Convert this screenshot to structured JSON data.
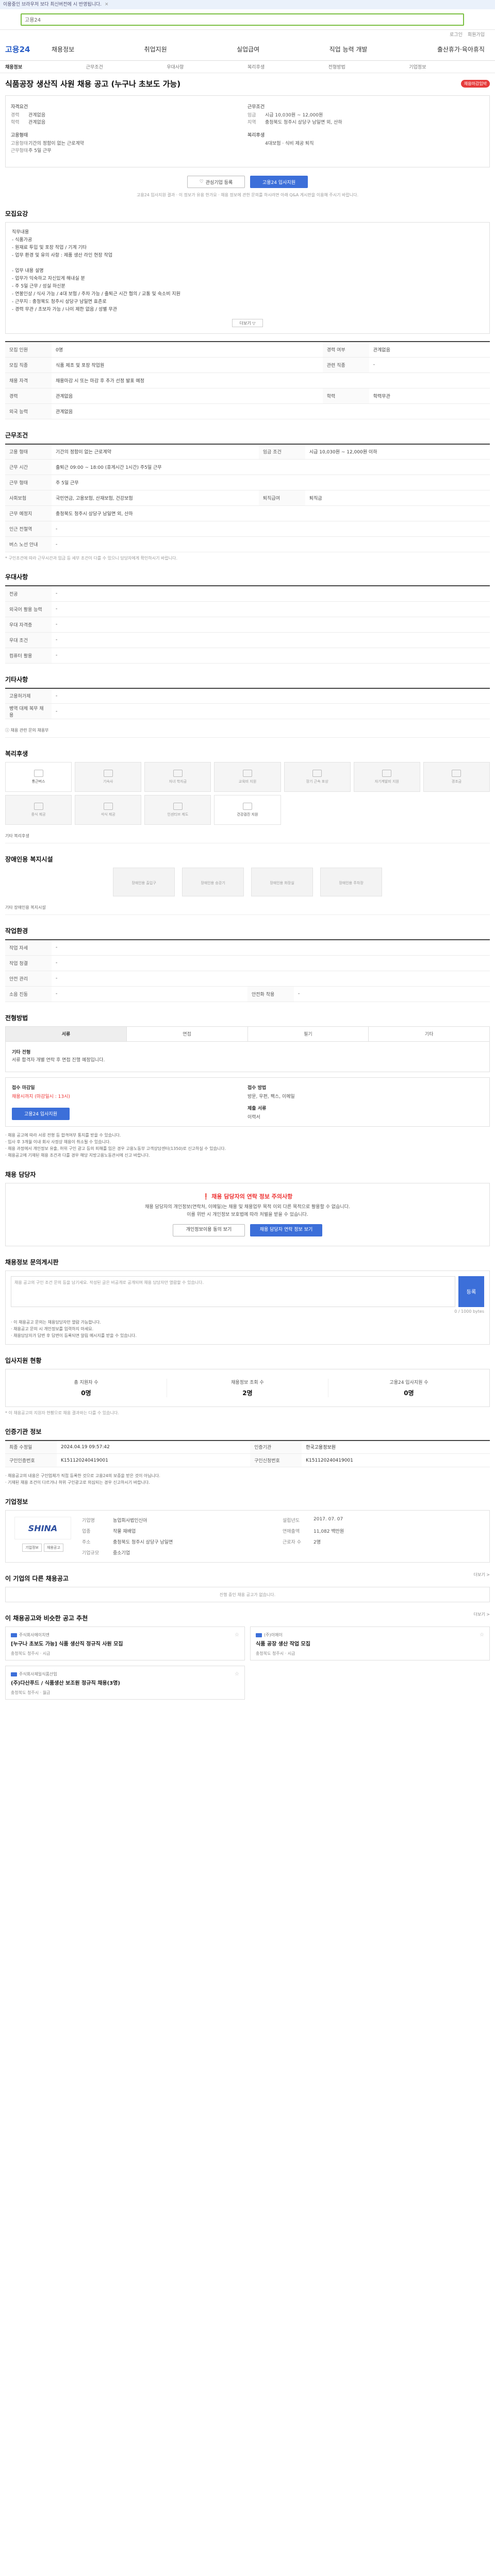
{
  "topbar": {
    "text": "이용중인 브라우저 보다 최신버전에 시 반영됩니다.",
    "close": "✕"
  },
  "search": {
    "icon": "search-icon",
    "text": "고용24"
  },
  "util": [
    "로그인",
    "회원가입"
  ],
  "gnb": {
    "logo": "고용24",
    "menu": [
      "채용정보",
      "취업지원",
      "실업급여",
      "직업 능력 개발",
      "출산휴가·육아휴직"
    ]
  },
  "subtabs": [
    "채용정보",
    "근무조건",
    "우대사항",
    "복리후생",
    "전형방법",
    "기업정보"
  ],
  "job": {
    "title": "식품공장 생산직 사원 채용 공고 (누구나 초보도 가능)",
    "badge": "채용마감임박",
    "sum_left": [
      {
        "label": "자격요건",
        "lines": [
          {
            "k": "경력",
            "v": "관계없음"
          },
          {
            "k": "학력",
            "v": "관계없음"
          }
        ]
      },
      {
        "label": "고용형태",
        "lines": [
          {
            "k": "고용형태",
            "v": "기간의 정함이 없는 근로계약"
          },
          {
            "k": "근무형태",
            "v": "주 5일 근무"
          }
        ]
      }
    ],
    "sum_right": [
      {
        "label": "근무조건",
        "lines": [
          {
            "k": "임금",
            "v": "시급 10,030원 ~ 12,000원"
          },
          {
            "k": "지역",
            "v": "충청북도 청주시 상당구 남일면 외, 산하"
          }
        ]
      },
      {
        "label": "복리후생",
        "lines": [
          {
            "k": "",
            "v": "4대보험 · 식비 제공 퇴직"
          }
        ]
      }
    ],
    "btn_interest": "관심기업 등록",
    "btn_apply": "고용24 입사지원",
    "apply_note": "고용24 입사지원 결과 · 이 정보가 유용 한가요 · 채용 정보에 관한 문의를 하시려면 아래 Q&A 게시판을 이용해 주시기 바랍니다."
  },
  "detail": {
    "title": "모집요강",
    "text": "직무내용\n - 식품가공\n - 원재료 투입 및 포장 작업 / 기계 기타\n - 업무 환경 및 유의 사항 : 제품 생산 라인 현장 작업\n\n - 업무 내용 설명\n - 업무가 익숙하고 자신있게 해내실 분\n - 주 5일 근무 / 성실 하신분\n - 연봉인상 / 식사 가능 / 4대 보험 / 주차 가능 / 출퇴근 시간 협의 / 교통 및 숙소비 지원\n - 근무지 : 충청북도 청주시 상당구 남일면 효촌로\n - 경력 무관 / 초보자 가능 / 나이 제한 없음 / 성별 무관",
    "more": "더보기 ▽",
    "table": [
      [
        "모집 인원",
        "0명",
        "경력 여부",
        "관계없음"
      ],
      [
        "모집 직종",
        "식품 제조 및 포장 작업원",
        "관련 직종",
        "-"
      ],
      [
        "채용 자격",
        "채용마감 시 또는 마감 후 추가 선정 발표 예정",
        "",
        ""
      ],
      [
        "경력",
        "관계없음",
        "학력",
        "학력무관"
      ],
      [
        "외국 능력",
        "관계없음",
        "",
        ""
      ]
    ]
  },
  "cond": {
    "title": "근무조건",
    "table": [
      [
        "고용 형태",
        "기간의 정함이 없는 근로계약",
        "임금 조건",
        "시급 10,030원 ~ 12,000원 이하"
      ],
      [
        "근무 시간",
        "출퇴근 09:00 ~ 18:00 (휴게시간 1시간) 주5일 근무",
        "",
        ""
      ],
      [
        "근무 형태",
        "주 5일 근무",
        "",
        ""
      ],
      [
        "사회보험",
        "국민연금, 고용보험, 산재보험, 건강보험",
        "퇴직급여",
        "퇴직금"
      ],
      [
        "근무 예정지",
        "충청북도 청주시 상당구 남일면 외, 산하",
        "",
        ""
      ],
      [
        "인근 전철역",
        "-",
        "",
        ""
      ],
      [
        "버스 노선 안내",
        "-",
        "",
        ""
      ]
    ],
    "map_btn": "지도 보기",
    "footnote": "* 구인조건에 따라 근무시간과 임금 등 세부 조건이 다를 수 있으니 담당자에게 확인하시기 바랍니다."
  },
  "pref": {
    "title": "우대사항",
    "table": [
      [
        "전공",
        "-"
      ],
      [
        "외국어 활용 능력",
        "-"
      ],
      [
        "우대 자격증",
        "-"
      ],
      [
        "우대 조건",
        "-"
      ],
      [
        "컴퓨터 활용",
        "-"
      ]
    ]
  },
  "etc": {
    "title": "기타사항",
    "table": [
      [
        "고용허가제",
        "-"
      ],
      [
        "병역 대체 복무 채용",
        "-"
      ]
    ],
    "link": "채용 관련 문의 채용부"
  },
  "welfare": {
    "title": "복리후생",
    "items": [
      "통근버스",
      "기숙사",
      "자녀 학자금",
      "교육비 지원",
      "장기 근속 포상",
      "자기계발비 지원",
      "경조금",
      "중식 제공",
      "석식 제공",
      "인센티브 제도",
      "건강검진 지원"
    ],
    "on_index": [
      0,
      10
    ],
    "etc_label": "기타 복리후생"
  },
  "disabled": {
    "title": "장애인용 복지시설",
    "items": [
      "장애인용 출입구",
      "장애인용 승강기",
      "장애인용 화장실",
      "장애인용 주차장"
    ],
    "etc_label": "기타 장애인용 복지시설"
  },
  "worksite": {
    "title": "작업환경",
    "table": [
      [
        "작업 자세",
        "-",
        "",
        ""
      ],
      [
        "작업 청결",
        "-",
        "",
        ""
      ],
      [
        "안전 관리",
        "-",
        "",
        ""
      ],
      [
        "소음 진동",
        "-",
        "안전화 착용",
        "-"
      ]
    ]
  },
  "process": {
    "title": "전형방법",
    "steps": [
      "서류",
      "면접",
      "필기",
      "기타"
    ],
    "active": 0,
    "body_title": "기타 전형",
    "body_text": "서류 합격자 개별 연락 후 면접 진행 예정입니다.",
    "deadline_label": "접수 마감일",
    "deadline": "채용시까지 (마감일시 : 13시)",
    "method_label": "접수 방법",
    "method": "방문, 우편, 팩스, 이메일",
    "apply_btn": "고용24 입사지원",
    "docs_label": "제출 서류",
    "docs": "이력서",
    "bullets": [
      "· 채용 공고에 따라 서류 전형 등 합격여부 통지를 받을 수 있습니다.",
      "· 입사 후 3개월 이내 회사 사정상 채용이 취소될 수 있습니다.",
      "· 채용 과정에서 개인정보 유출, 허위 구인 광고 등의 피해를 입은 경우 고용노동부 고객상담센터(1350)로 신고하실 수 있습니다.",
      "· 채용공고에 기재된 채용 조건과 다를 경우 해당 지방고용노동관서에 신고 바랍니다."
    ]
  },
  "warning": {
    "title": "채용 담당자",
    "headline": "채용 담당자의 연락 정보 주의사항",
    "lines": [
      "채용 담당자의 개인정보(연락처, 이메일)는 채용 및 채용업무 목적 이외 다른 목적으로 활용할 수 없습니다.",
      "이를 위반 시 개인정보 보호법에 따라 처벌을 받을 수 있습니다."
    ],
    "btn1": "개인정보이용 동의 보기",
    "btn2": "채용 담당자 연락 정보 보기"
  },
  "qa": {
    "title": "채용정보 문의게시판",
    "placeholder": "채용 공고의 구인 조건 문의 등을 남기세요. 작성된 글은 비공개로 공개되며 채용 담당자만 열람할 수 있습니다.",
    "write": "등록",
    "count": "0 / 1000 bytes",
    "bullets": [
      "· 이 채용공고 문의는 채용담당자만 열람 가능합니다.",
      "· 채용공고 문의 시 개인정보를 입력하지 마세요.",
      "· 채용담당자가 답변 후 답변이 등록되면 알림 메시지를 받을 수 있습니다."
    ]
  },
  "stats": {
    "title": "입사지원 현황",
    "items": [
      {
        "label": "총 지원자 수",
        "value": "0명"
      },
      {
        "label": "채용정보 조회 수",
        "value": "2명"
      },
      {
        "label": "고용24 입사지원 수",
        "value": "0명"
      }
    ],
    "note": "* 이 채용공고의 지원자 현황으로 채용 결과와는 다를 수 있습니다."
  },
  "info": {
    "title": "인증기관 정보",
    "table": [
      [
        "최종 수정일",
        "2024.04.19 09:57:42",
        "인증기관",
        "한국고용정보원"
      ],
      [
        "구인인증번호",
        "K151120240419001",
        "구인신청번호",
        "K151120240419001"
      ]
    ],
    "bullets": [
      "· 채용공고의 내용은 구인업체가 직접 등록한 것으로 고용24의 보증을 받은 것이 아닙니다.",
      "· 기재된 채용 조건이 다르거나 허위 구인광고로 의심되는 경우 신고하시기 바랍니다."
    ]
  },
  "corp": {
    "title": "기업정보",
    "logo": "SHINA",
    "btn1": "기업정보",
    "btn2": "채용공고",
    "info": [
      [
        "기업명",
        "농업회사법인신아",
        "설립년도",
        "2017. 07. 07"
      ],
      [
        "업종",
        "작물 재배업",
        "연매출액",
        "11,082 백만원"
      ],
      [
        "주소",
        "충청북도 청주시 상당구 남일면",
        "근로자 수",
        "2명"
      ],
      [
        "기업규모",
        "중소기업",
        "",
        ""
      ]
    ]
  },
  "others": {
    "title": "이 기업의 다른 채용공고",
    "more": "더보기 >",
    "empty": "진행 중인 채용 공고가 없습니다."
  },
  "recs": {
    "title": "이 채용공고와 비슷한 공고 추천",
    "more": "더보기 >",
    "items": [
      {
        "co": "주식회사에이치엔",
        "title": "[누구나 초보도 가능] 식품 생산직 정규직 사원 모집",
        "meta": "충청북도 청주시 · 시급"
      },
      {
        "co": "(주)이에이",
        "title": "식품 공장 생산 작업 모집",
        "meta": "충청북도 청주시 · 시급"
      },
      {
        "co": "주식회사제일식품산업",
        "title": "(주)다산푸드 / 식품생산 보조원 정규직 채용(3명)",
        "meta": "충청북도 청주시 · 월급"
      },
      {
        "co": "",
        "title": "",
        "meta": ""
      }
    ]
  }
}
